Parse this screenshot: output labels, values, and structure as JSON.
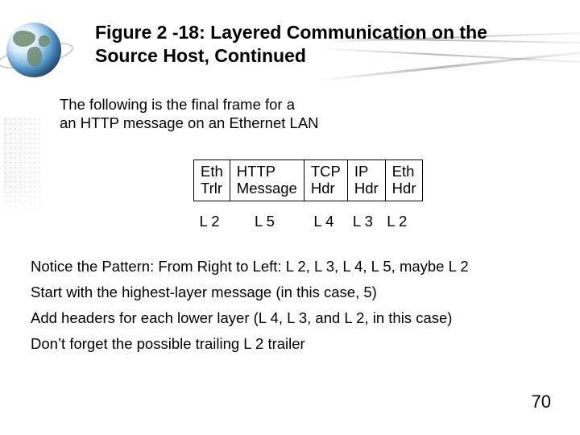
{
  "title_line1": "Figure 2 -18: Layered Communication on the",
  "title_line2": "Source Host, Continued",
  "intro_line1": "The following is the final frame for a",
  "intro_line2": "an HTTP message on an Ethernet LAN",
  "frame": {
    "cells": [
      {
        "l1": "Eth",
        "l2": "Trlr"
      },
      {
        "l1": "HTTP",
        "l2": "Message"
      },
      {
        "l1": "TCP",
        "l2": "Hdr"
      },
      {
        "l1": "IP",
        "l2": "Hdr"
      },
      {
        "l1": "Eth",
        "l2": "Hdr"
      }
    ],
    "layers": [
      "L 2",
      "L 5",
      "L 4",
      "L 3",
      "L 2"
    ]
  },
  "body1": "Notice the Pattern: From Right to Left: L 2, L 3, L 4, L 5, maybe L 2",
  "body2": "Start with the highest-layer message (in this case, 5)",
  "body3": "Add headers for each lower layer (L 4, L 3, and L 2, in this case)",
  "body4": "Don’t forget the possible trailing L 2 trailer",
  "page_number": "70"
}
